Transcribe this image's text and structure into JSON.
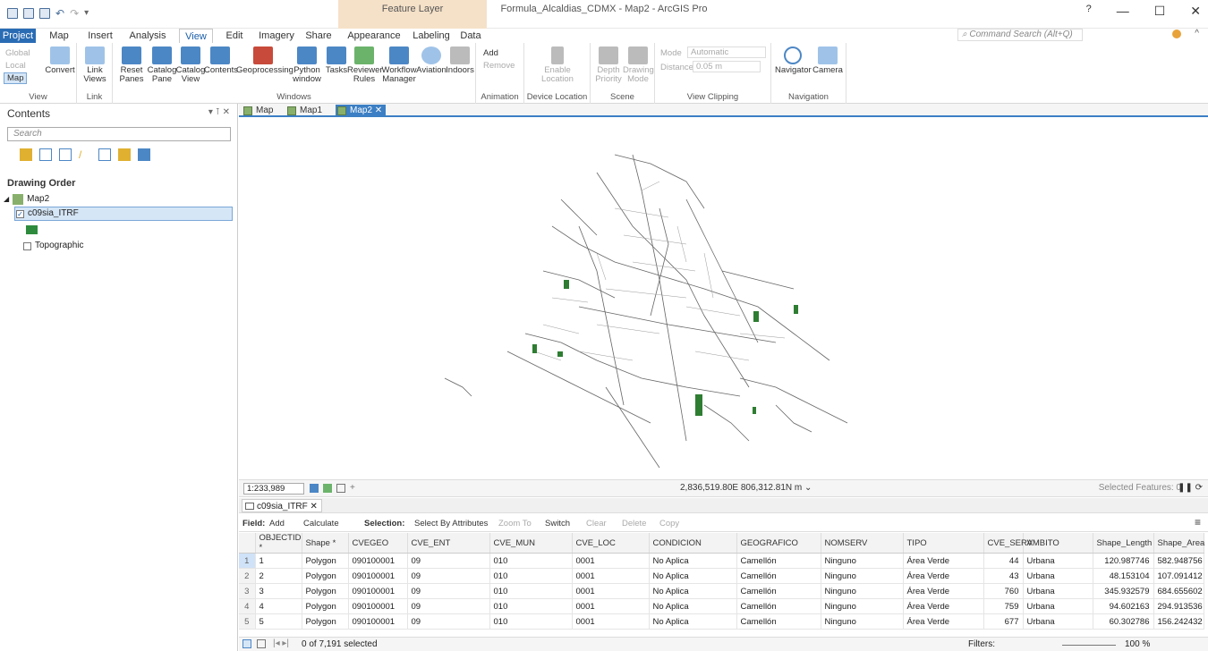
{
  "window": {
    "title": "Formula_Alcaldias_CDMX - Map2 - ArcGIS Pro",
    "context_tab": "Feature Layer",
    "help": "?",
    "minimize": "—",
    "maximize": "☐",
    "close": "✕"
  },
  "tabs": [
    "Project",
    "Map",
    "Insert",
    "Analysis",
    "View",
    "Edit",
    "Imagery",
    "Share",
    "Appearance",
    "Labeling",
    "Data"
  ],
  "command_search": {
    "placeholder": "Command Search (Alt+Q)"
  },
  "ribbon": {
    "view": {
      "label": "View",
      "global": "Global",
      "local": "Local",
      "map": "Map",
      "convert": "Convert"
    },
    "link": {
      "label": "Link",
      "link_views": "Link Views"
    },
    "windows": {
      "label": "Windows",
      "reset_panes": "Reset Panes",
      "catalog_pane": "Catalog Pane",
      "catalog_view": "Catalog View",
      "contents": "Contents",
      "geoprocessing": "Geoprocessing",
      "python_window": "Python window",
      "tasks": "Tasks",
      "reviewer_rules": "Reviewer Rules",
      "workflow_manager": "Workflow Manager",
      "aviation": "Aviation",
      "indoors": "Indoors"
    },
    "animation": {
      "label": "Animation",
      "add": "Add",
      "remove": "Remove"
    },
    "device_location": {
      "label": "Device Location",
      "enable": "Enable Location"
    },
    "scene": {
      "label": "Scene",
      "depth_priority": "Depth Priority",
      "drawing_mode": "Drawing Mode"
    },
    "view_clipping": {
      "label": "View Clipping",
      "mode_label": "Mode",
      "mode_value": "Automatic",
      "distance_label": "Distance",
      "distance_value": "0.05 m"
    },
    "navigation": {
      "label": "Navigation",
      "navigator": "Navigator",
      "camera": "Camera"
    }
  },
  "contents": {
    "title": "Contents",
    "search_placeholder": "Search",
    "drawing_order": "Drawing Order",
    "map_name": "Map2",
    "layer_name": "c09sia_ITRF",
    "basemap": "Topographic"
  },
  "map_tabs": [
    "Map",
    "Map1",
    "Map2"
  ],
  "status": {
    "scale": "1:233,989",
    "coordinates": "2,836,519.80E 806,312.81N m",
    "selected_features": "Selected Features: 0"
  },
  "table": {
    "tab_name": "c09sia_ITRF",
    "toolbar": {
      "field": "Field:",
      "add": "Add",
      "calculate": "Calculate",
      "selection": "Selection:",
      "select_by_attributes": "Select By Attributes",
      "zoom_to": "Zoom To",
      "switch": "Switch",
      "clear": "Clear",
      "delete": "Delete",
      "copy": "Copy"
    },
    "columns": [
      "OBJECTID *",
      "Shape *",
      "CVEGEO",
      "CVE_ENT",
      "CVE_MUN",
      "CVE_LOC",
      "CONDICION",
      "GEOGRAFICO",
      "NOMSERV",
      "TIPO",
      "CVE_SERV",
      "AMBITO",
      "Shape_Length",
      "Shape_Area"
    ],
    "rows": [
      [
        "1",
        "Polygon",
        "090100001",
        "09",
        "010",
        "0001",
        "No Aplica",
        "Camellón",
        "Ninguno",
        "Área Verde",
        "44",
        "Urbana",
        "120.987746",
        "582.948756"
      ],
      [
        "2",
        "Polygon",
        "090100001",
        "09",
        "010",
        "0001",
        "No Aplica",
        "Camellón",
        "Ninguno",
        "Área Verde",
        "43",
        "Urbana",
        "48.153104",
        "107.091412"
      ],
      [
        "3",
        "Polygon",
        "090100001",
        "09",
        "010",
        "0001",
        "No Aplica",
        "Camellón",
        "Ninguno",
        "Área Verde",
        "760",
        "Urbana",
        "345.932579",
        "684.655602"
      ],
      [
        "4",
        "Polygon",
        "090100001",
        "09",
        "010",
        "0001",
        "No Aplica",
        "Camellón",
        "Ninguno",
        "Área Verde",
        "759",
        "Urbana",
        "94.602163",
        "294.913536"
      ],
      [
        "5",
        "Polygon",
        "090100001",
        "09",
        "010",
        "0001",
        "No Aplica",
        "Camellón",
        "Ninguno",
        "Área Verde",
        "677",
        "Urbana",
        "60.302786",
        "156.242432"
      ]
    ],
    "footer": {
      "selected": "0 of 7,191 selected",
      "filters": "Filters:",
      "zoom": "100 %"
    }
  }
}
